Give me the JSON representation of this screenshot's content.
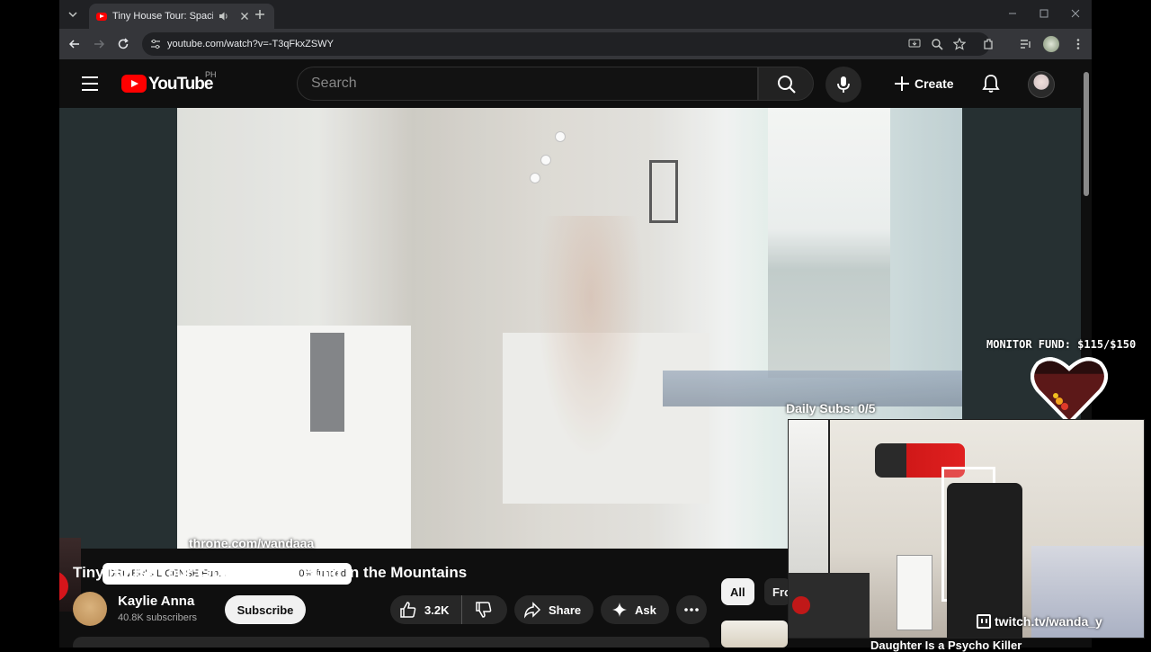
{
  "browser": {
    "tab_title": "Tiny House Tour: Spacious DIY Build in the Mountains",
    "url": "youtube.com/watch?v=-T3qFkxZSWY"
  },
  "youtube": {
    "logo_text": "YouTube",
    "country_code": "PH",
    "search_placeholder": "Search",
    "create_label": "Create"
  },
  "video": {
    "title": "Tiny House Tour: Spacious DIY Build in the Mountains",
    "channel_name": "Kaylie Anna",
    "subscribers": "40.8K subscribers",
    "subscribe_label": "Subscribe",
    "likes": "3.2K",
    "share_label": "Share",
    "ask_label": "Ask"
  },
  "chips": {
    "all": "All",
    "from": "From"
  },
  "recommended": {
    "title": "Daughter Is a Psycho Killer"
  },
  "overlay": {
    "throne_url": "throne.com/wandaaa",
    "fund_item": "DRIVER'S LICENSE Fun...",
    "fund_status": "0% funded",
    "monitor_fund": "MONITOR FUND: $115/$150",
    "monitor_fund_raised": 115,
    "monitor_fund_goal": 150,
    "daily_subs": "Daily Subs: 0/5",
    "twitch": "twitch.tv/wanda_y"
  },
  "colors": {
    "youtube_red": "#ff0000",
    "page_bg": "#0f0f0f",
    "chip_active": "#f1f1f1"
  }
}
